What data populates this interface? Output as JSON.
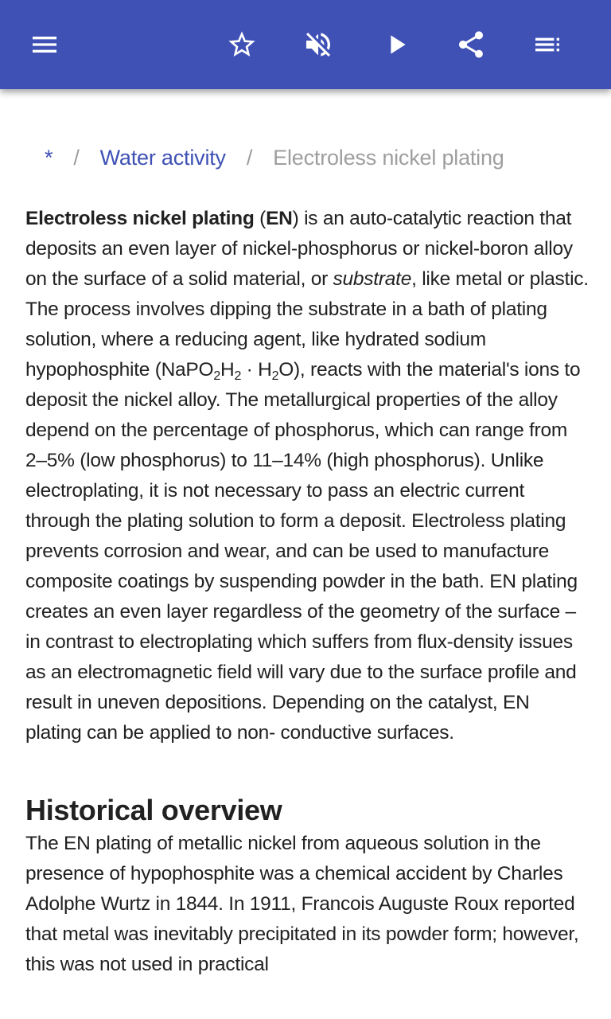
{
  "appbar": {
    "color": "#3F51B5",
    "icons": [
      "menu-icon",
      "star-outline-icon",
      "volume-off-icon",
      "play-icon",
      "share-icon",
      "playlist-icon"
    ]
  },
  "breadcrumb": {
    "home": "*",
    "separator": "/",
    "parent": "Water activity",
    "current": "Electroless nickel plating"
  },
  "article": {
    "intro": {
      "term": "Electroless nickel plating",
      "paren_open": " (",
      "abbr": "EN",
      "text1": ") is an auto-catalytic reaction that deposits an even layer of nickel-phosphorus or nickel-boron alloy on the surface of a solid material, or ",
      "italic": "substrate",
      "text2": ", like metal or plastic. The process involves dipping the substrate in a bath of plating solution, where a reducing agent, like hydrated sodium hypophosphite (NaPO",
      "sub1": "2",
      "text3": "H",
      "sub2": "2",
      "text4": " · H",
      "sub3": "2",
      "text5": "O), reacts with the material's ions to deposit the nickel alloy. The metallurgical properties of the alloy depend on the percentage of phosphorus, which can range from 2–5% (low phosphorus) to 11–14% (high phosphorus). Unlike electroplating, it is not necessary to pass an electric current through the plating solution to form a deposit. Electroless plating prevents corrosion and wear, and can be used to manufacture composite coatings by suspending powder in the bath. EN plating creates an even layer regardless of the geometry of the surface – in contrast to electroplating which suffers from flux-density issues as an electromagnetic field will vary due to the surface profile and result in uneven depositions. Depending on the catalyst, EN plating can be applied to non- conductive surfaces."
    },
    "section_heading": "Historical overview",
    "section_text": "The EN plating of metallic nickel from aqueous solution in the presence of hypophosphite was a chemical accident by Charles Adolphe Wurtz in 1844. In 1911, Francois Auguste Roux reported that metal was inevitably precipitated in its powder form; however, this was not used in practical"
  }
}
